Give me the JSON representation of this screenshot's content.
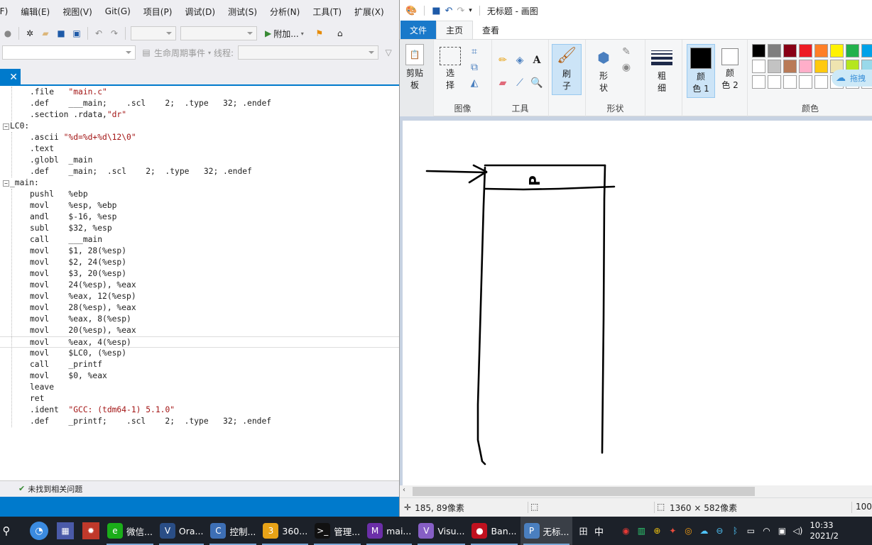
{
  "vs": {
    "menu": [
      "(F)",
      "编辑(E)",
      "视图(V)",
      "Git(G)",
      "项目(P)",
      "调试(D)",
      "测试(S)",
      "分析(N)",
      "工具(T)",
      "扩展(X)"
    ],
    "attach_label": "附加...",
    "lifecycle_label": "生命周期事件",
    "thread_label": "线程:",
    "code": [
      {
        "t": ".file   ",
        "s": "\"main.c\""
      },
      {
        "t": ".def    ___main;    .scl    2;  .type   32; .endef"
      },
      {
        "t": ".section .rdata,",
        "s": "\"dr\""
      },
      {
        "label": "LC0:"
      },
      {
        "t": ".ascii ",
        "s": "\"%d=%d+%d\\12\\0\""
      },
      {
        "t": ".text"
      },
      {
        "t": ".globl  _main"
      },
      {
        "t": ".def    _main;  .scl    2;  .type   32; .endef"
      },
      {
        "label": "_main:"
      },
      {
        "t": "pushl   %ebp"
      },
      {
        "t": "movl    %esp, %ebp"
      },
      {
        "t": "andl    $-16, %esp"
      },
      {
        "t": "subl    $32, %esp"
      },
      {
        "t": "call    ___main"
      },
      {
        "t": "movl    $1, 28(%esp)"
      },
      {
        "t": "movl    $2, 24(%esp)"
      },
      {
        "t": "movl    $3, 20(%esp)"
      },
      {
        "t": "movl    24(%esp), %eax"
      },
      {
        "t": "movl    %eax, 12(%esp)"
      },
      {
        "t": "movl    28(%esp), %eax"
      },
      {
        "t": "movl    %eax, 8(%esp)"
      },
      {
        "t": "movl    20(%esp), %eax"
      },
      {
        "t": "movl    %eax, 4(%esp)"
      },
      {
        "t": "movl    $LC0, (%esp)"
      },
      {
        "t": "call    _printf"
      },
      {
        "t": "movl    $0, %eax"
      },
      {
        "t": "leave"
      },
      {
        "t": "ret"
      },
      {
        "t": ".ident  ",
        "s": "\"GCC: (tdm64-1) 5.1.0\""
      },
      {
        "t": ".def    _printf;    .scl    2;  .type   32; .endef"
      }
    ],
    "status_text": "未找到相关问题"
  },
  "paint": {
    "title": "无标题 - 画图",
    "tabs": [
      "文件",
      "主页",
      "查看"
    ],
    "groups": {
      "clipboard_label_1": "剪贴",
      "clipboard_label_2": "板",
      "select_label_1": "选",
      "select_label_2": "择",
      "image_label": "图像",
      "tools_label": "工具",
      "brush_label_1": "刷",
      "brush_label_2": "子",
      "shapes_label_1": "形",
      "shapes_label_2": "状",
      "shapes_group_label": "形状",
      "size_label_1": "粗",
      "size_label_2": "细",
      "color1_label_1": "颜",
      "color1_label_2": "色 1",
      "color2_label_1": "颜",
      "color2_label_2": "色 2",
      "colors_group_label": "颜色",
      "baidu_label": "拖拽"
    },
    "colors": {
      "row1": [
        "#000000",
        "#7f7f7f",
        "#880015",
        "#ed1c24",
        "#ff7f27",
        "#fff200",
        "#22b14c",
        "#00a2e8"
      ],
      "row2": [
        "#ffffff",
        "#c3c3c3",
        "#b97a57",
        "#ffaec9",
        "#ffc90e",
        "#efe4b0",
        "#b5e61d",
        "#99d9ea"
      ],
      "row3": [
        "#ffffff",
        "#ffffff",
        "#ffffff",
        "#ffffff",
        "#ffffff",
        "#ffffff",
        "#ffffff",
        "#ffffff"
      ],
      "color1": "#000000",
      "color2": "#ffffff"
    },
    "drawing_text": "P",
    "status": {
      "cursor_pos": "185, 89像素",
      "canvas_size": "1360 × 582像素",
      "zoom": "100"
    }
  },
  "taskbar": {
    "items": [
      {
        "label": "微信...",
        "color": "#1aad19",
        "icon": "e"
      },
      {
        "label": "Ora...",
        "color": "#2a4e86",
        "icon": "V"
      },
      {
        "label": "控制...",
        "color": "#3d6fb5",
        "icon": "C"
      },
      {
        "label": "360...",
        "color": "#e8a317",
        "icon": "3"
      },
      {
        "label": "管理...",
        "color": "#111111",
        "icon": ">_"
      },
      {
        "label": "mai...",
        "color": "#6b2fa8",
        "icon": "M"
      },
      {
        "label": "Visu...",
        "color": "#865fc5",
        "icon": "V"
      },
      {
        "label": "Ban...",
        "color": "#c0111f",
        "icon": "●"
      },
      {
        "label": "无标...",
        "color": "#4a7fbf",
        "icon": "P"
      }
    ],
    "ime": "中",
    "time": "10:33",
    "date": "2021/2"
  }
}
